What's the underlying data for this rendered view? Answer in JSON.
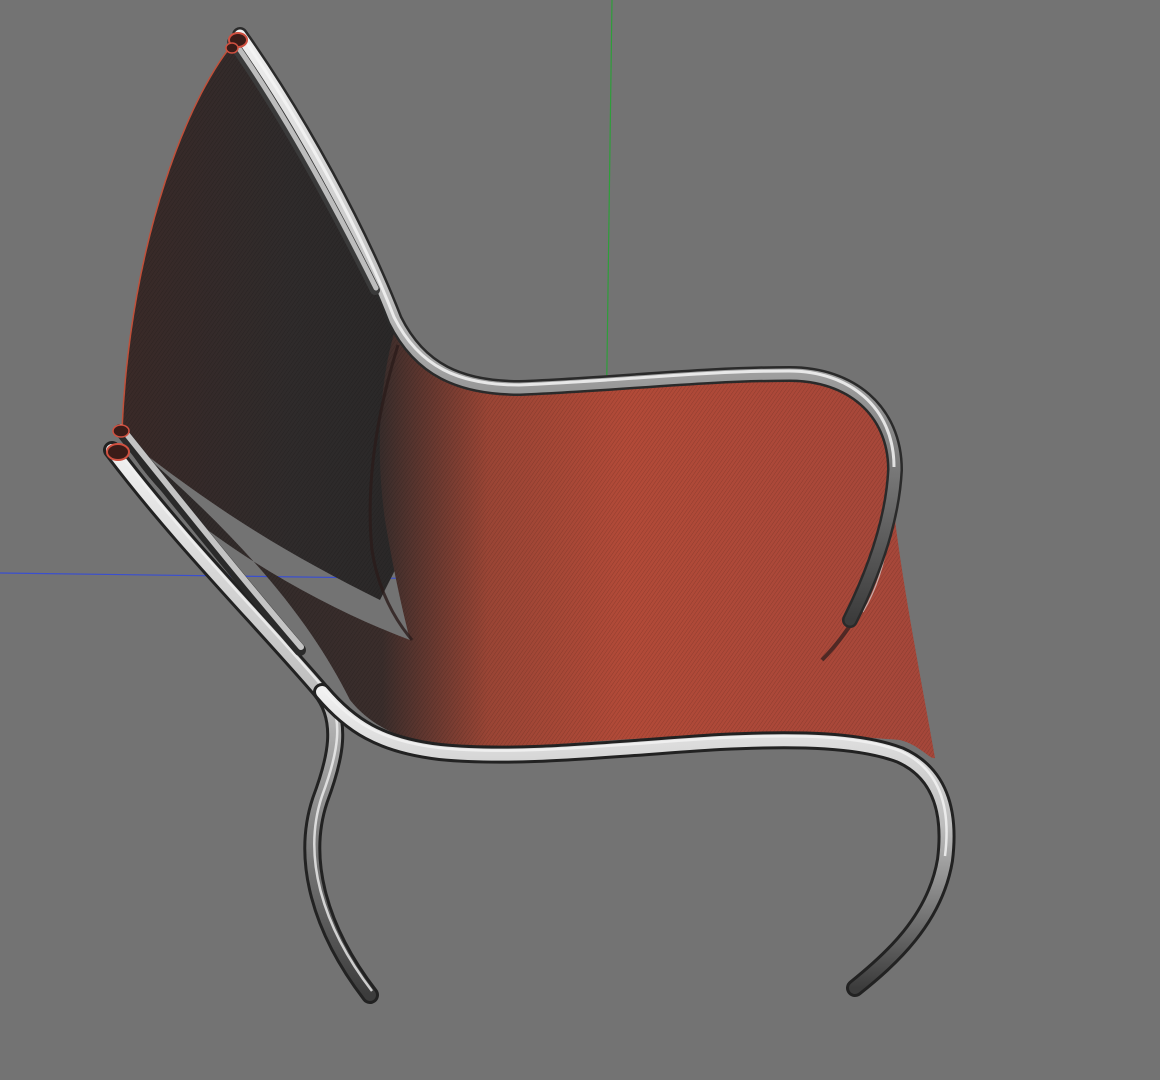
{
  "viewport": {
    "background_color": "#737373",
    "axes": {
      "x_axis_color": "#3a4fd0",
      "y_axis_color": "#2e9e3a",
      "z_axis_color": "#8a3a2a"
    },
    "model": {
      "surface_color": "#b04836",
      "surface_dark_color": "#2c2a2a",
      "tube_color": "#c8c8c8",
      "tube_icon": "chair-model-icon"
    }
  }
}
